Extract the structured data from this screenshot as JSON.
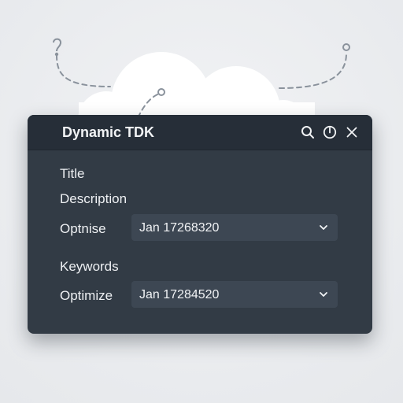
{
  "window": {
    "title": "Dynamic TDK"
  },
  "toolbar": {
    "icons": [
      "search-icon",
      "power-icon",
      "close-icon"
    ]
  },
  "form": {
    "title_label": "Title",
    "description_label": "Description",
    "description_optimise_label": "Optnise",
    "description_select_value": "Jan 17268320",
    "keywords_label": "Keywords",
    "keywords_optimize_label": "Optimize",
    "keywords_select_value": "Jan 17284520"
  },
  "colors": {
    "panel": "#323b45",
    "titlebar": "#262e38",
    "select": "#3d4753",
    "text": "#eef0f3",
    "background": "#eceef1"
  }
}
